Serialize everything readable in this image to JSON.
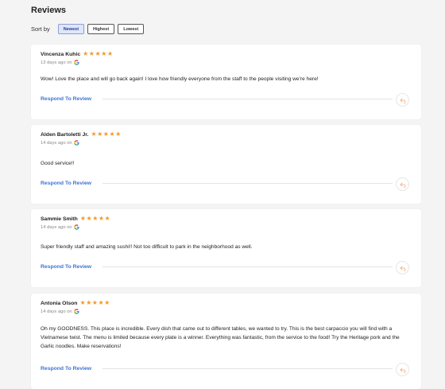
{
  "page": {
    "title": "Reviews"
  },
  "sort": {
    "label": "Sort by",
    "options": [
      "Newest",
      "Highest",
      "Lowest"
    ],
    "selected": "Newest"
  },
  "colors": {
    "star": "#f39a24",
    "link": "#3a73d6",
    "active_sort_bg": "#dfe6fb"
  },
  "reviews": [
    {
      "name": "Vincenza Kuhic",
      "stars": 5,
      "time": "13 days ago on",
      "source_icon": "google-icon",
      "text": "Wow! Love the place and will go back again! I love how friendly everyone from the staff to the people visiting we're here!",
      "respond_label": "Respond To Review"
    },
    {
      "name": "Alden Bartoletti Jr.",
      "stars": 5,
      "time": "14 days ago on",
      "source_icon": "google-icon",
      "text": "Good service!!",
      "respond_label": "Respond To Review"
    },
    {
      "name": "Sammie Smith",
      "stars": 5,
      "time": "14 days ago on",
      "source_icon": "google-icon",
      "text": "Super friendly staff and amazing sushi!! Not too difficult to park in the neighborhood as well.",
      "respond_label": "Respond To Review"
    },
    {
      "name": "Antonia Olson",
      "stars": 5,
      "time": "14 days ago on",
      "source_icon": "google-icon",
      "text": "Oh my GOODNESS. This place is incredible. Every dish that came out to different tables, we wanted to try. This is the best carpaccio you will find with a Vietnamese twist. The menu is limited because every plate is a winner. Everything was fantastic, from the service to the food! Try the Heritage pork and the Garlic noodles. Make reservations!",
      "respond_label": "Respond To Review"
    }
  ]
}
